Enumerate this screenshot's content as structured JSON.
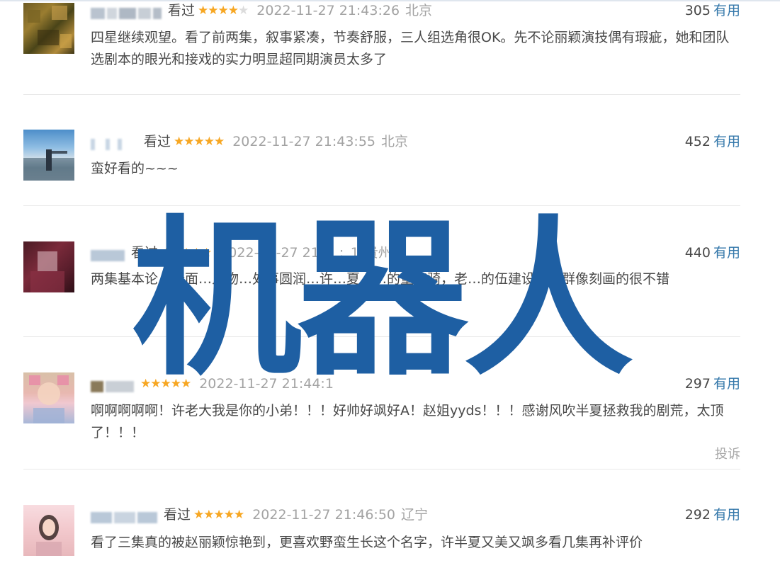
{
  "comments": [
    {
      "username": "J.J.J.",
      "watched": "看过",
      "stars": "★★★★",
      "stars_off": "★",
      "time": "2022-11-27 21:43:26",
      "location": "北京",
      "votes": "305",
      "useful": "有用",
      "content": "四星继续观望。看了前两集，叙事紧凑，节奏舒服，三人组选角很OK。先不论丽颖演技偶有瑕疵，她和团队选剧本的眼光和接戏的实力明显超同期演员太多了"
    },
    {
      "username": "...",
      "watched": "看过",
      "stars": "★★★★★",
      "stars_off": "",
      "time": "2022-11-27 21:43:55",
      "location": "北京",
      "votes": "452",
      "useful": "有用",
      "content": "蛮好看的~~~"
    },
    {
      "username": "Mr",
      "watched": "看过",
      "stars": "★★★★★",
      "stars_off": "",
      "time": "2022-11-27 21:5_:_1",
      "location": "贵州",
      "votes": "440",
      "useful": "有用",
      "content": "两集基本论…全面…人物…处事圆润…许…夏，…的童骁骑，老…的伍建设等，群像刻画的很不错"
    },
    {
      "username": "..",
      "watched": "",
      "stars": "★★★★★",
      "stars_off": "",
      "time": "2022-11-27 21:44:1",
      "location": "",
      "votes": "297",
      "useful": "有用",
      "content": "啊啊啊啊啊！许老大我是你的小弟！！！好帅好飒好A！赵姐yyds！！！感谢风吹半夏拯救我的剧荒，太顶了！！！",
      "report": "投诉"
    },
    {
      "username": "Foggy",
      "watched": "看过",
      "stars": "★★★★★",
      "stars_off": "",
      "time": "2022-11-27 21:46:50",
      "location": "辽宁",
      "votes": "292",
      "useful": "有用",
      "content": "看了三集真的被赵丽颖惊艳到，更喜欢野蛮生长这个名字，许半夏又美又飒多看几集再补评价"
    }
  ],
  "watermark": "机器人",
  "colors": {
    "link": "#3377aa",
    "star": "#f7a723",
    "meta_gray": "#a3a3a3",
    "watermark": "#1e5fa3"
  }
}
